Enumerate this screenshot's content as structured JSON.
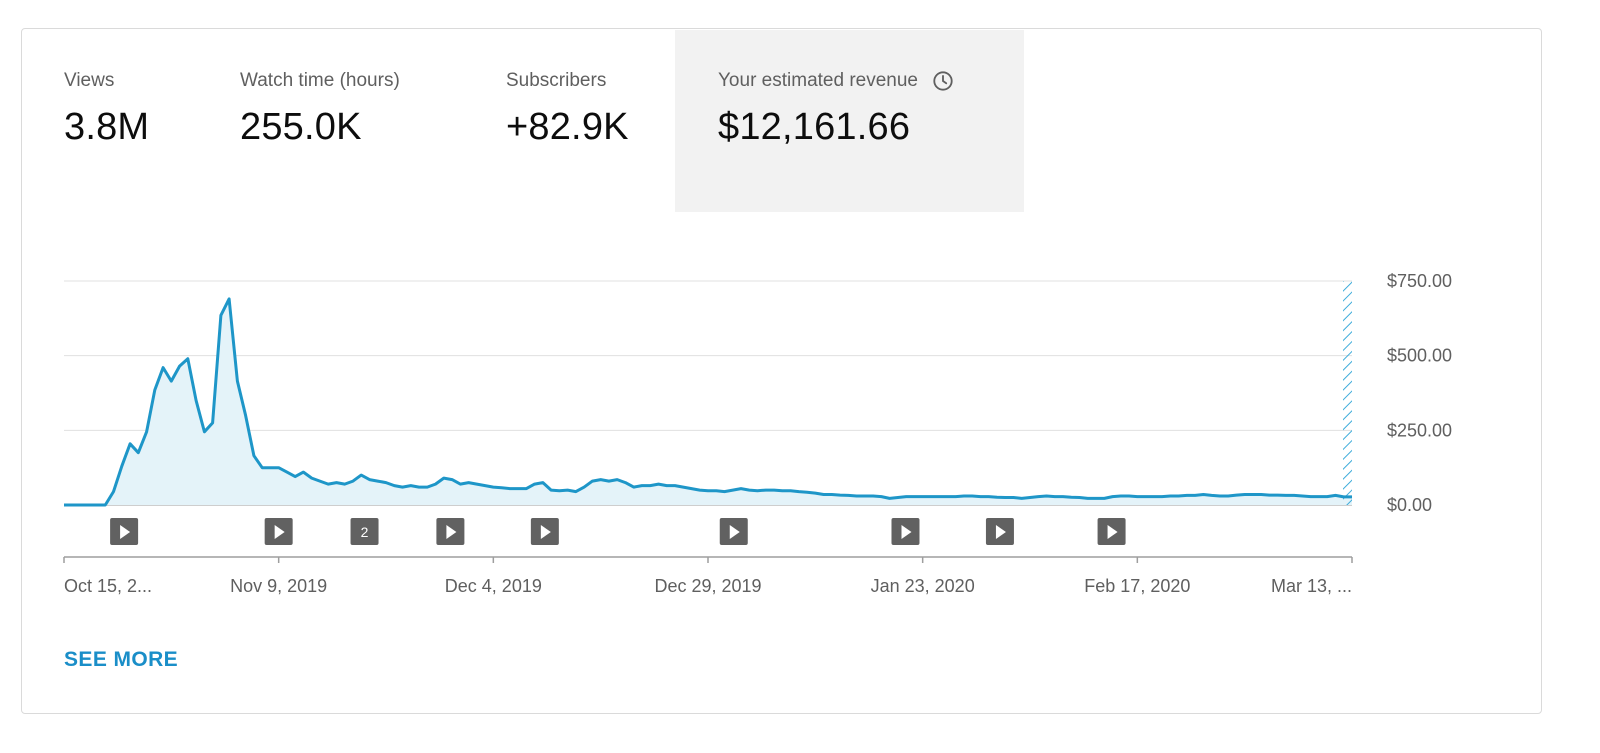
{
  "metrics": [
    {
      "label": "Views",
      "value": "3.8M"
    },
    {
      "label": "Watch time (hours)",
      "value": "255.0K"
    },
    {
      "label": "Subscribers",
      "value": "+82.9K"
    },
    {
      "label": "Your estimated revenue",
      "value": "$12,161.66",
      "icon": "clock-icon",
      "selected": true
    }
  ],
  "see_more_label": "SEE MORE",
  "colors": {
    "line": "#1e96c8",
    "fill": "#e4f3f9",
    "marker": "#616161",
    "grid": "#e0e0e0",
    "selected_bg": "#f2f2f2"
  },
  "chart_data": {
    "type": "area",
    "ylim": [
      0,
      750
    ],
    "y_ticks": [
      "$750.00",
      "$500.00",
      "$250.00",
      "$0.00"
    ],
    "y_tick_values": [
      750,
      500,
      250,
      0
    ],
    "x_tick_labels": [
      "Oct 15, 2...",
      "Nov 9, 2019",
      "Dec 4, 2019",
      "Dec 29, 2019",
      "Jan 23, 2020",
      "Feb 17, 2020",
      "Mar 13, ..."
    ],
    "x_tick_days": [
      0,
      25,
      50,
      75,
      100,
      125,
      150
    ],
    "x_days_total": 150,
    "series": [
      {
        "values": [
          0,
          0,
          0,
          0,
          0,
          0,
          45,
          130,
          205,
          175,
          245,
          385,
          460,
          415,
          465,
          490,
          350,
          245,
          275,
          635,
          690,
          415,
          300,
          165,
          125,
          125,
          125,
          110,
          95,
          110,
          90,
          80,
          70,
          75,
          70,
          80,
          100,
          85,
          80,
          75,
          65,
          60,
          65,
          60,
          60,
          70,
          90,
          85,
          70,
          75,
          70,
          65,
          60,
          58,
          55,
          55,
          55,
          70,
          75,
          50,
          48,
          50,
          45,
          60,
          80,
          85,
          80,
          85,
          75,
          60,
          65,
          65,
          70,
          65,
          65,
          60,
          55,
          50,
          48,
          48,
          45,
          50,
          55,
          50,
          48,
          50,
          50,
          48,
          48,
          45,
          43,
          40,
          35,
          35,
          33,
          32,
          30,
          30,
          30,
          28,
          22,
          25,
          28,
          28,
          28,
          28,
          28,
          28,
          28,
          30,
          30,
          28,
          28,
          26,
          25,
          25,
          22,
          25,
          28,
          30,
          28,
          28,
          26,
          25,
          22,
          22,
          22,
          28,
          30,
          30,
          28,
          28,
          28,
          28,
          30,
          30,
          32,
          32,
          35,
          32,
          30,
          30,
          33,
          35,
          35,
          35,
          33,
          33,
          32,
          32,
          30,
          28,
          28,
          28,
          32,
          27,
          27
        ]
      }
    ],
    "video_markers": [
      {
        "day": 7,
        "label": ""
      },
      {
        "day": 25,
        "label": ""
      },
      {
        "day": 35,
        "label": "2"
      },
      {
        "day": 45,
        "label": ""
      },
      {
        "day": 56,
        "label": ""
      },
      {
        "day": 78,
        "label": ""
      },
      {
        "day": 98,
        "label": ""
      },
      {
        "day": 109,
        "label": ""
      },
      {
        "day": 122,
        "label": ""
      }
    ],
    "grid": true
  }
}
